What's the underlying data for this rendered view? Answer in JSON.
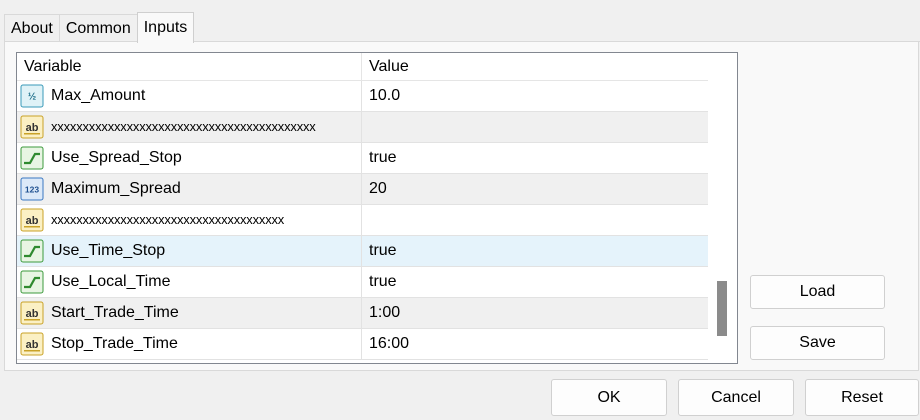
{
  "tabs": [
    {
      "label": "About"
    },
    {
      "label": "Common"
    },
    {
      "label": "Inputs",
      "active": true
    }
  ],
  "grid": {
    "headers": {
      "variable": "Variable",
      "value": "Value"
    },
    "selected_row": 5,
    "rows": [
      {
        "icon": "fraction-icon",
        "name": "Max_Amount",
        "value": "10.0"
      },
      {
        "icon": "text-ab-icon",
        "name": "xxxxxxxxxxxxxxxxxxxxxxxxxxxxxxxxxxxxxxxxxx",
        "value": ""
      },
      {
        "icon": "bool-toggle-icon",
        "name": "Use_Spread_Stop",
        "value": "true"
      },
      {
        "icon": "integer-123-icon",
        "name": "Maximum_Spread",
        "value": "20"
      },
      {
        "icon": "text-ab-icon",
        "name": "xxxxxxxxxxxxxxxxxxxxxxxxxxxxxxxxxxxxx",
        "value": ""
      },
      {
        "icon": "bool-toggle-icon",
        "name": "Use_Time_Stop",
        "value": "true"
      },
      {
        "icon": "bool-toggle-icon",
        "name": "Use_Local_Time",
        "value": "true"
      },
      {
        "icon": "text-ab-icon",
        "name": "Start_Trade_Time",
        "value": "1:00"
      },
      {
        "icon": "text-ab-icon",
        "name": "Stop_Trade_Time",
        "value": "16:00"
      }
    ],
    "scroll_position": 0.92
  },
  "side_buttons": {
    "load": "Load",
    "save": "Save"
  },
  "dialog_buttons": {
    "ok": "OK",
    "cancel": "Cancel",
    "reset": "Reset"
  },
  "colors": {
    "selected_row": "#e5f3fb",
    "alt_row": "#f0f0f0",
    "bool_icon": "#3c9a3c",
    "text_icon": "#d6a726",
    "number_icon": "#3a78c2"
  }
}
